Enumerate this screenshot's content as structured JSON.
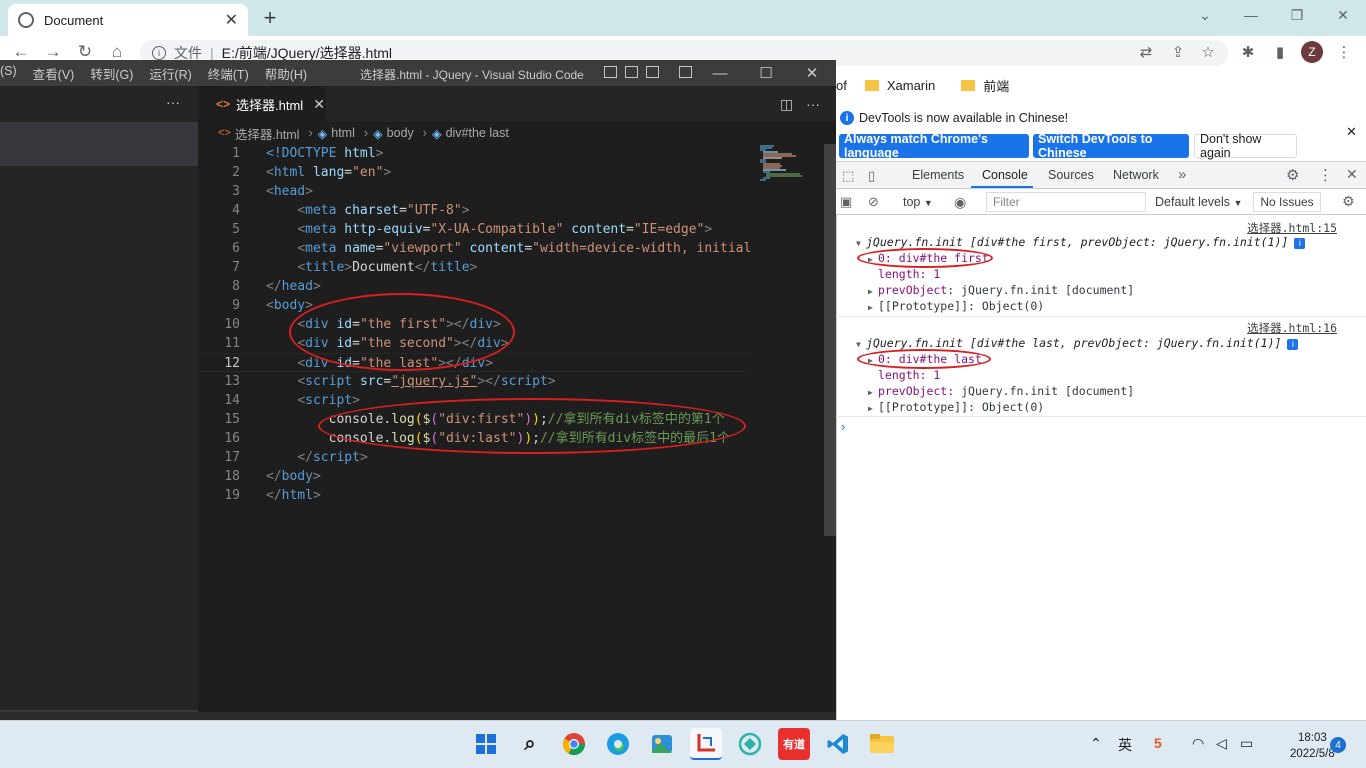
{
  "chrome": {
    "tab_title": "Document",
    "file_label": "文件",
    "url": "E:/前端/JQuery/选择器.html",
    "avatar_letter": "Z",
    "bookmarks": [
      {
        "label": "of"
      },
      {
        "label": "Xamarin"
      },
      {
        "label": "前端"
      }
    ]
  },
  "vscode": {
    "menu": [
      "(S)",
      "查看(V)",
      "转到(G)",
      "运行(R)",
      "终端(T)",
      "帮助(H)"
    ],
    "window_title": "选择器.html - JQuery - Visual Studio Code",
    "tab_label": "选择器.html",
    "breadcrumb": {
      "file": "选择器.html",
      "html": "html",
      "body": "body",
      "div": "div#the last"
    },
    "current_line": "12",
    "line_numbers": [
      "1",
      "2",
      "3",
      "4",
      "5",
      "6",
      "7",
      "8",
      "9",
      "10",
      "11",
      "12",
      "13",
      "14",
      "15",
      "16",
      "17",
      "18",
      "19"
    ],
    "code": {
      "doctype_kw": "<!DOCTYPE",
      "doctype_val": "html",
      "lang_val": "\"en\"",
      "charset_val": "\"UTF-8\"",
      "http_equiv_val": "\"X-UA-Compatible\"",
      "content_val": "\"IE=edge\"",
      "viewport_val": "\"viewport\"",
      "viewport_content": "\"width=device-width, initial-",
      "title_text": "Document",
      "div1_id": "\"the first\"",
      "div2_id": "\"the second\"",
      "div3_id": "\"the last\"",
      "script_src": "\"jquery.js\"",
      "log1_arg": "\"div:first\"",
      "log1_comment": "//拿到所有div标签中的第1个",
      "log2_arg": "\"div:last\"",
      "log2_comment": "//拿到所有div标签中的最后1个"
    }
  },
  "devtools": {
    "banner_text": "DevTools is now available in Chinese!",
    "btn_match": "Always match Chrome's language",
    "btn_switch": "Switch DevTools to Chinese",
    "btn_dont": "Don't show again",
    "tabs": [
      "Elements",
      "Console",
      "Sources",
      "Network"
    ],
    "context": "top",
    "filter_placeholder": "Filter",
    "levels": "Default levels",
    "issues": "No Issues",
    "entries": [
      {
        "source": "选择器.html:15",
        "summary": "jQuery.fn.init [div#the first, prevObject: jQuery.fn.init(1)]",
        "item0": "0: div#the first",
        "length": "length: 1",
        "prev_key": "prevObject:",
        "prev_val": "jQuery.fn.init [document]",
        "proto_key": "[[Prototype]]:",
        "proto_val": "Object(0)"
      },
      {
        "source": "选择器.html:16",
        "summary": "jQuery.fn.init [div#the last, prevObject: jQuery.fn.init(1)]",
        "item0": "0: div#the last",
        "length": "length: 1",
        "prev_key": "prevObject:",
        "prev_val": "jQuery.fn.init [document]",
        "proto_key": "[[Prototype]]:",
        "proto_val": "Object(0)"
      }
    ]
  },
  "taskbar": {
    "time": "18:03",
    "date": "2022/5/8",
    "notif_count": "4",
    "app_youdao": "有道"
  }
}
